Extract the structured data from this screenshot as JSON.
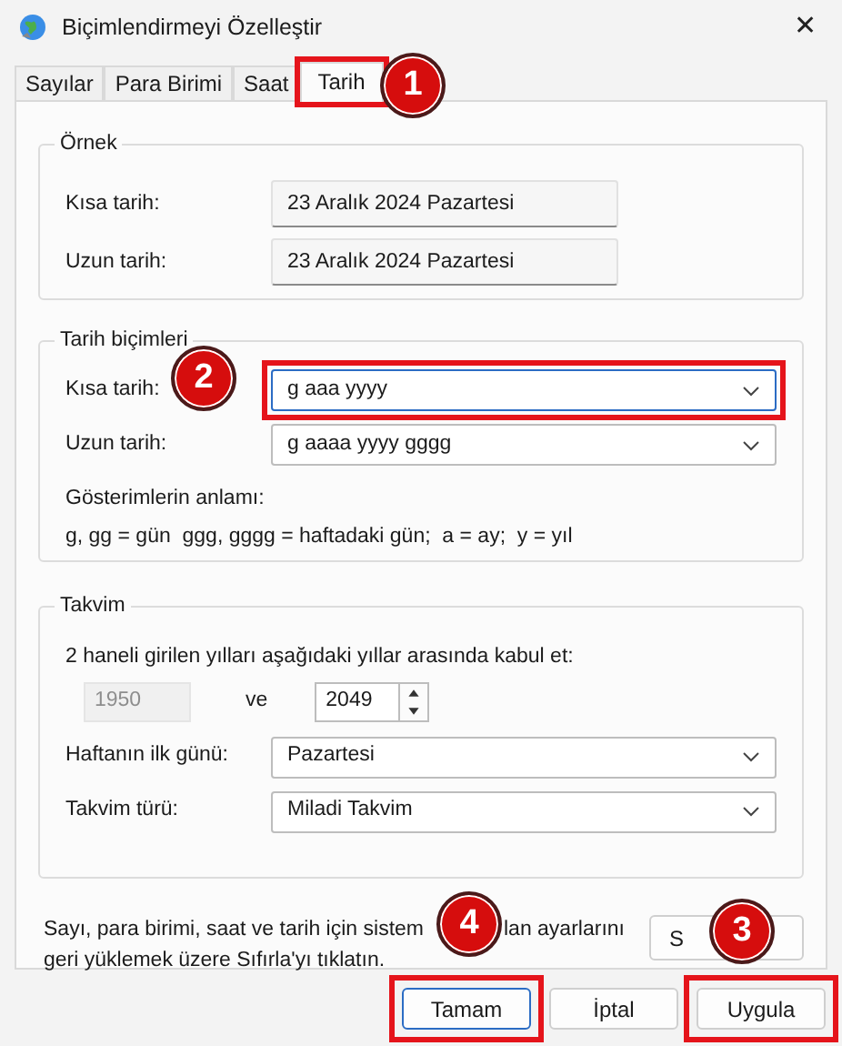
{
  "window": {
    "title": "Biçimlendirmeyi Özelleştir",
    "close": "✕"
  },
  "tabs": [
    {
      "label": "Sayılar",
      "selected": false,
      "highlighted": false
    },
    {
      "label": "Para Birimi",
      "selected": false,
      "highlighted": false
    },
    {
      "label": "Saat",
      "selected": false,
      "highlighted": false
    },
    {
      "label": "Tarih",
      "selected": true,
      "highlighted": true
    }
  ],
  "example": {
    "title": "Örnek",
    "rows": [
      {
        "label": "Kısa tarih:",
        "value": "23 Aralık 2024 Pazartesi"
      },
      {
        "label": "Uzun tarih:",
        "value": "23 Aralık 2024 Pazartesi"
      }
    ]
  },
  "date_formats": {
    "title": "Tarih biçimleri",
    "rows": [
      {
        "label": "Kısa tarih:",
        "value": "g aaa yyyy",
        "focused": true,
        "highlighted": true
      },
      {
        "label": "Uzun tarih:",
        "value": "g aaaa yyyy gggg",
        "focused": false,
        "highlighted": false
      }
    ],
    "legend_title": "Gösterimlerin anlamı:",
    "legend": "g, gg = gün  ggg, gggg = haftadaki gün;  a = ay;  y = yıl"
  },
  "calendar": {
    "title": "Takvim",
    "two_digit_text": "2 haneli girilen yılları aşağıdaki yıllar arasında kabul et:",
    "from_year": {
      "value": "1950",
      "disabled": true
    },
    "and_label": "ve",
    "to_year": {
      "value": "2049",
      "disabled": false
    },
    "rows": [
      {
        "label": "Haftanın ilk günü:",
        "value": "Pazartesi"
      },
      {
        "label": "Takvim türü:",
        "value": "Miladi Takvim"
      }
    ]
  },
  "reset": {
    "text_parts": [
      "Sayı, para birimi, saat ve tarih için sistem",
      "lan ayarlarını"
    ],
    "text_line2": "geri yüklemek üzere Sıfırla'yı tıklatın.",
    "button": "S"
  },
  "buttons": [
    {
      "label": "Tamam",
      "default": true,
      "highlighted": true
    },
    {
      "label": "İptal",
      "default": false,
      "highlighted": false
    },
    {
      "label": "Uygula",
      "default": false,
      "highlighted": true
    }
  ],
  "callouts": [
    {
      "number": "1"
    },
    {
      "number": "2"
    },
    {
      "number": "3"
    },
    {
      "number": "4"
    }
  ]
}
